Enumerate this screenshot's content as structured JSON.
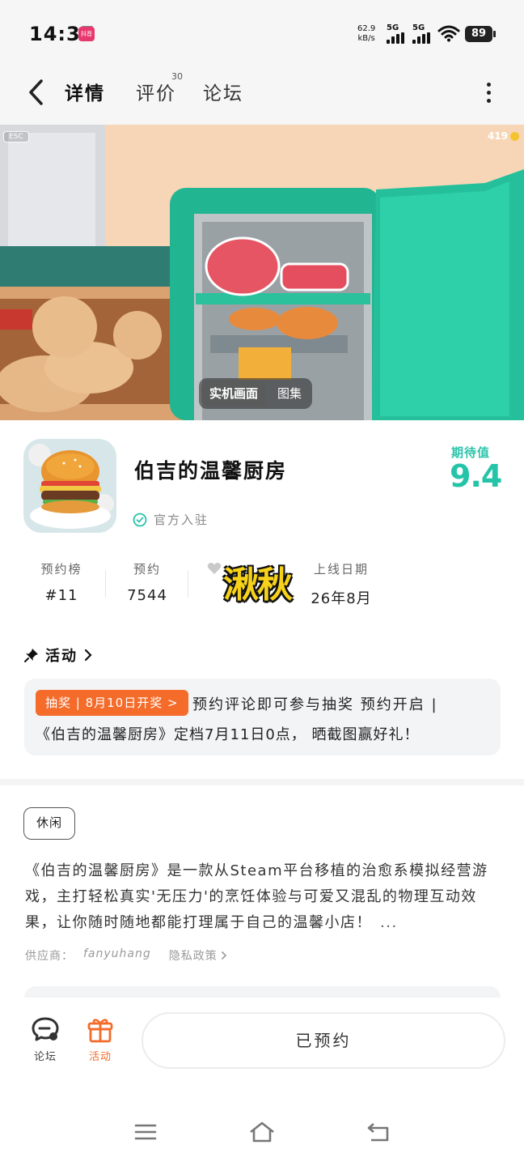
{
  "status_bar": {
    "time": "14:37",
    "app_badge": "抖音",
    "net_speed_value": "62.9",
    "net_speed_unit": "kB/s",
    "sim1": "5G",
    "sim2": "5G",
    "battery": "89"
  },
  "nav": {
    "tabs": [
      {
        "label": "详情",
        "active": true
      },
      {
        "label": "评价",
        "count": "30"
      },
      {
        "label": "论坛"
      }
    ]
  },
  "hero": {
    "esc_label": "ESC",
    "coin_count": "419",
    "switch": [
      "实机画面",
      "图集"
    ]
  },
  "game": {
    "title": "伯吉的温馨厨房",
    "official_label": "官方入驻",
    "expect_label": "期待值",
    "expect_score": "9.4"
  },
  "stats": [
    {
      "key": "预约榜",
      "value": "#11"
    },
    {
      "key": "预约",
      "value": "7544"
    },
    {
      "key": "上线日期",
      "value": "26年8月"
    }
  ],
  "watermark": "湫秋",
  "activity": {
    "heading": "活动",
    "badge": "抽奖 | 8月10日开奖 >",
    "line1": "预约评论即可参与抽奖 预约开启 |",
    "line2": "《伯吉的温馨厨房》定档7月11日0点，  晒截图赢好礼！"
  },
  "intro": {
    "tag": "休闲",
    "description": "《伯吉的温馨厨房》是一款从Steam平台移植的治愈系模拟经营游戏，主打轻松真实'无压力'的烹饪体验与可爱又混乱的物理互动效果，让你随时随地都能打理属于自己的温馨小店！",
    "more": "...",
    "vendor_label": "供应商：",
    "vendor_name": "fanyuhang",
    "privacy": "隐私政策"
  },
  "bottom_bar": {
    "forum": "论坛",
    "activity": "活动",
    "reserve_button": "已预约"
  },
  "colors": {
    "accent_teal": "#2ad1b6",
    "accent_orange": "#f46b2a"
  }
}
